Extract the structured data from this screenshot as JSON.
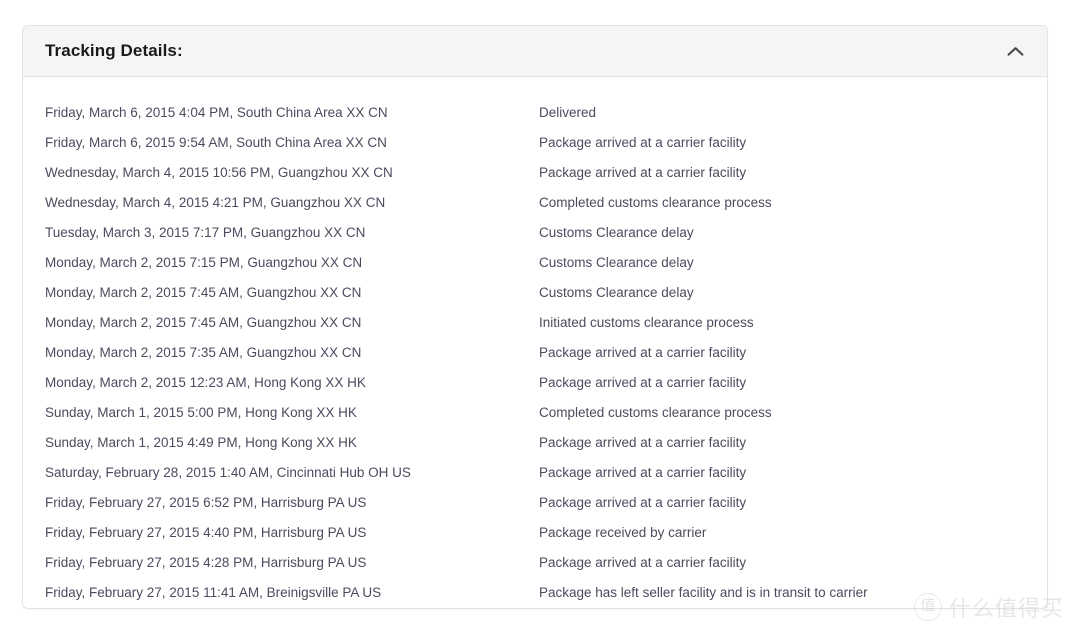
{
  "card": {
    "title": "Tracking Details:",
    "collapse_icon": "chevron-up-icon",
    "collapsed": false
  },
  "columns": {
    "when": "",
    "status": ""
  },
  "events": [
    {
      "when": "Friday, March 6, 2015 4:04 PM, South China Area XX CN",
      "status": "Delivered"
    },
    {
      "when": "Friday, March 6, 2015 9:54 AM, South China Area XX CN",
      "status": "Package arrived at a carrier facility"
    },
    {
      "when": "Wednesday, March 4, 2015 10:56 PM, Guangzhou XX CN",
      "status": "Package arrived at a carrier facility"
    },
    {
      "when": "Wednesday, March 4, 2015 4:21 PM, Guangzhou XX CN",
      "status": "Completed customs clearance process"
    },
    {
      "when": "Tuesday, March 3, 2015 7:17 PM, Guangzhou XX CN",
      "status": "Customs Clearance delay"
    },
    {
      "when": "Monday, March 2, 2015 7:15 PM, Guangzhou XX CN",
      "status": "Customs Clearance delay"
    },
    {
      "when": "Monday, March 2, 2015 7:45 AM, Guangzhou XX CN",
      "status": "Customs Clearance delay"
    },
    {
      "when": "Monday, March 2, 2015 7:45 AM, Guangzhou XX CN",
      "status": "Initiated customs clearance process"
    },
    {
      "when": "Monday, March 2, 2015 7:35 AM, Guangzhou XX CN",
      "status": "Package arrived at a carrier facility"
    },
    {
      "when": "Monday, March 2, 2015 12:23 AM, Hong Kong XX HK",
      "status": "Package arrived at a carrier facility"
    },
    {
      "when": "Sunday, March 1, 2015 5:00 PM, Hong Kong XX HK",
      "status": "Completed customs clearance process"
    },
    {
      "when": "Sunday, March 1, 2015 4:49 PM, Hong Kong XX HK",
      "status": "Package arrived at a carrier facility"
    },
    {
      "when": "Saturday, February 28, 2015 1:40 AM, Cincinnati Hub OH US",
      "status": "Package arrived at a carrier facility"
    },
    {
      "when": "Friday, February 27, 2015 6:52 PM, Harrisburg PA US",
      "status": "Package arrived at a carrier facility"
    },
    {
      "when": "Friday, February 27, 2015 4:40 PM, Harrisburg PA US",
      "status": "Package received by carrier"
    },
    {
      "when": "Friday, February 27, 2015 4:28 PM, Harrisburg PA US",
      "status": "Package arrived at a carrier facility"
    },
    {
      "when": "Friday, February 27, 2015 11:41 AM, Breinigsville PA US",
      "status": "Package has left seller facility and is in transit to carrier"
    }
  ],
  "watermark": {
    "badge": "值",
    "text": "什么值得买"
  },
  "colors": {
    "header_bg": "#f5f5f5",
    "border": "#e3e3e3",
    "text": "#4b4b5e",
    "title": "#1a1a1a",
    "watermark": "#d4d4d9"
  }
}
